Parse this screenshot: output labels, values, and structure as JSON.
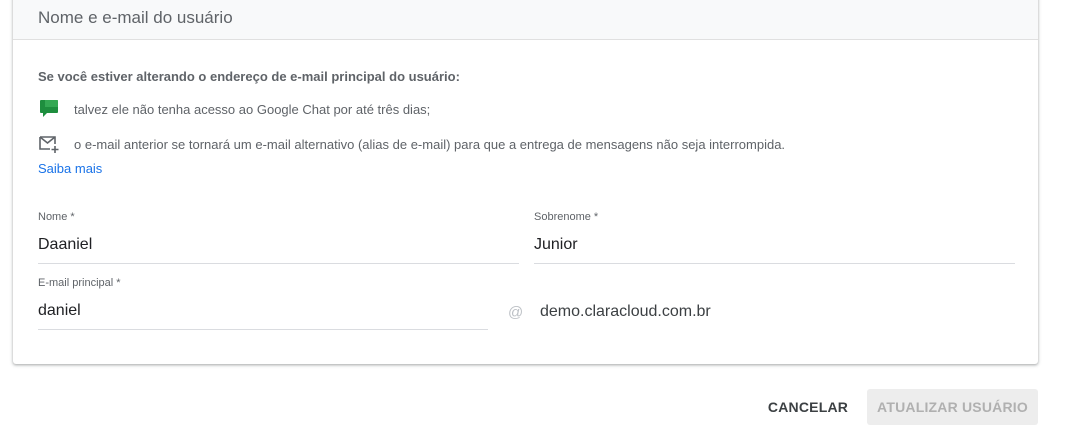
{
  "card": {
    "title": "Nome e e-mail do usuário",
    "notice_heading": "Se você estiver alterando o endereço de e-mail principal do usuário:",
    "notices": [
      {
        "icon": "google-chat-icon",
        "text": "talvez ele não tenha acesso ao Google Chat por até três dias;"
      },
      {
        "icon": "mail-add-icon",
        "text": "o e-mail anterior se tornará um e-mail alternativo (alias de e-mail) para que a entrega de mensagens não seja interrompida."
      }
    ],
    "learn_more": "Saiba mais"
  },
  "form": {
    "first_name": {
      "label": "Nome *",
      "value": "Daaniel"
    },
    "last_name": {
      "label": "Sobrenome *",
      "value": "Junior"
    },
    "primary_email": {
      "label": "E-mail principal *",
      "value": "daniel"
    },
    "at_sign": "@",
    "domain": "demo.claracloud.com.br"
  },
  "actions": {
    "cancel": "CANCELAR",
    "update": "ATUALIZAR USUÁRIO"
  },
  "colors": {
    "chat_green": "#1e8e3e",
    "link_blue": "#1a73e8",
    "disabled_bg": "#ededed"
  }
}
